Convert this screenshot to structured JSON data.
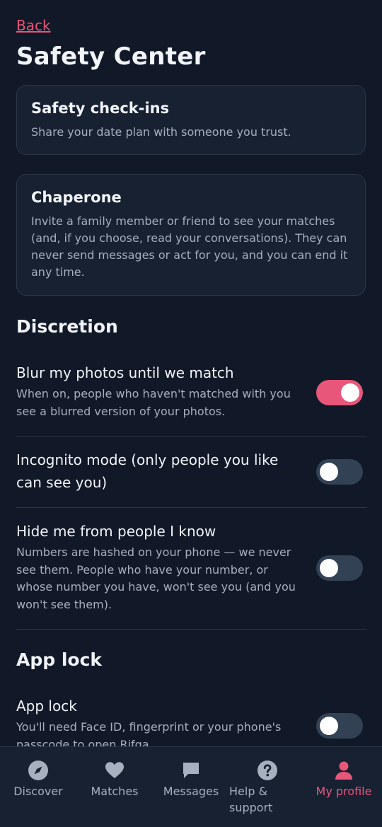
{
  "header": {
    "back_label": "Back",
    "title": "Safety Center"
  },
  "cards": [
    {
      "title": "Safety check-ins",
      "text": "Share your date plan with someone you trust."
    },
    {
      "title": "Chaperone",
      "text": "Invite a family member or friend to see your matches (and, if you choose, read your conversations). They can never send messages or act for you, and you can end it any time."
    }
  ],
  "discretion": {
    "section_title": "Discretion",
    "items": [
      {
        "title": "Blur my photos until we match",
        "text": "When on, people who haven't matched with you see a blurred version of your photos.",
        "enabled": true
      },
      {
        "title": "Incognito mode (only people you like can see you)",
        "text": "",
        "enabled": false
      },
      {
        "title": "Hide me from people I know",
        "text": "Numbers are hashed on your phone — we never see them. People who have your number, or whose number you have, won't see you (and you won't see them).",
        "enabled": false
      }
    ]
  },
  "app_lock": {
    "section_title": "App lock",
    "item": {
      "title": "App lock",
      "text": "You'll need Face ID, fingerprint or your phone's passcode to open Rifqa.",
      "enabled": false
    }
  },
  "tabbar": {
    "items": [
      {
        "label": "Discover",
        "icon": "compass-icon",
        "active": false
      },
      {
        "label": "Matches",
        "icon": "heart-icon",
        "active": false
      },
      {
        "label": "Messages",
        "icon": "chat-bubble-icon",
        "active": false
      },
      {
        "label": "Help & support",
        "icon": "question-circle-icon",
        "active": false
      },
      {
        "label": "My profile",
        "icon": "person-icon",
        "active": true
      }
    ]
  },
  "colors": {
    "background": "#111827",
    "surface": "#172132",
    "accent": "#e8567a",
    "muted_text": "#a7b0be",
    "toggle_off": "#334155"
  }
}
